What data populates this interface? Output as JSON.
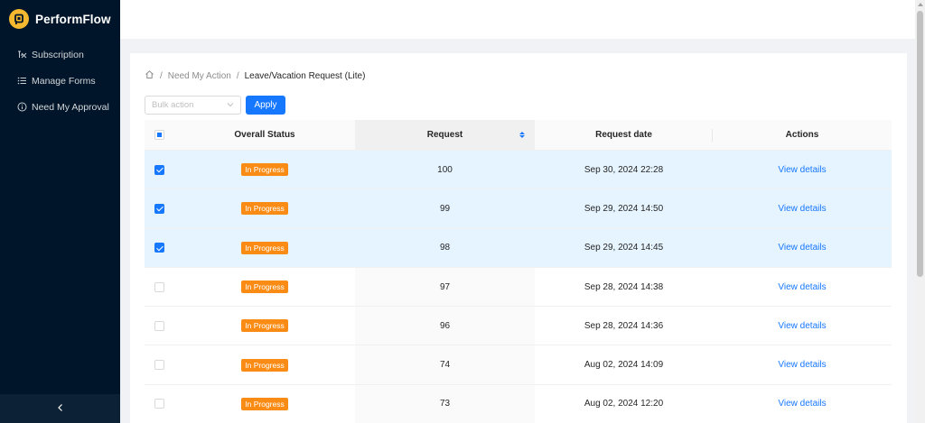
{
  "brand": {
    "name": "PerformFlow",
    "accent": "#f5b82e"
  },
  "sidebar": {
    "items": [
      {
        "label": "Subscription",
        "icon": "subscription-icon"
      },
      {
        "label": "Manage Forms",
        "icon": "list-icon"
      },
      {
        "label": "Need My Approval",
        "icon": "info-circle-icon"
      }
    ],
    "collapse_icon": "chevron-left-icon"
  },
  "breadcrumb": {
    "home_icon": "home-icon",
    "items": [
      "Need My Action",
      "Leave/Vacation Request (Lite)"
    ],
    "separator": "/"
  },
  "toolbar": {
    "bulk_placeholder": "Bulk action",
    "apply_label": "Apply"
  },
  "table": {
    "columns": [
      "Overall Status",
      "Request",
      "Request date",
      "Actions"
    ],
    "rows": [
      {
        "checked": true,
        "status": "In Progress",
        "request": "100",
        "date": "Sep 30, 2024 22:28",
        "action": "View details"
      },
      {
        "checked": true,
        "status": "In Progress",
        "request": "99",
        "date": "Sep 29, 2024 14:50",
        "action": "View details"
      },
      {
        "checked": true,
        "status": "In Progress",
        "request": "98",
        "date": "Sep 29, 2024 14:45",
        "action": "View details"
      },
      {
        "checked": false,
        "status": "In Progress",
        "request": "97",
        "date": "Sep 28, 2024 14:38",
        "action": "View details"
      },
      {
        "checked": false,
        "status": "In Progress",
        "request": "96",
        "date": "Sep 28, 2024 14:36",
        "action": "View details"
      },
      {
        "checked": false,
        "status": "In Progress",
        "request": "74",
        "date": "Aug 02, 2024 14:09",
        "action": "View details"
      },
      {
        "checked": false,
        "status": "In Progress",
        "request": "73",
        "date": "Aug 02, 2024 12:20",
        "action": "View details"
      }
    ]
  },
  "colors": {
    "primary": "#1677ff",
    "status_in_progress": "#fa8c16",
    "sidebar_bg": "#001529"
  }
}
